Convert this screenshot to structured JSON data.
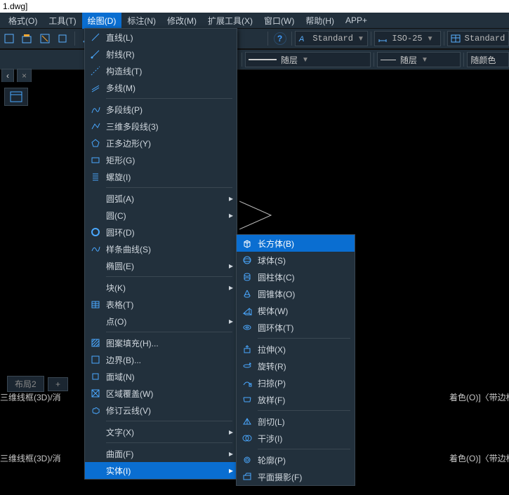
{
  "title": "1.dwg]",
  "menubar": [
    "格式(O)",
    "工具(T)",
    "绘图(D)",
    "标注(N)",
    "修改(M)",
    "扩展工具(X)",
    "窗口(W)",
    "帮助(H)",
    "APP+"
  ],
  "menubar_active": 2,
  "toolbar": {
    "style1": "Standard",
    "style2": "ISO-25",
    "style3": "Standard",
    "layer1": "随层",
    "layer2": "随层",
    "layer3": "随颜色"
  },
  "tabs": {
    "left": "‹",
    "right": "×"
  },
  "draw_menu": [
    {
      "label": "直线(L)",
      "icon": "line-icon"
    },
    {
      "label": "射线(R)",
      "icon": "ray-icon"
    },
    {
      "label": "构造线(T)",
      "icon": "xline-icon"
    },
    {
      "label": "多线(M)",
      "icon": "mline-icon"
    },
    {
      "div": true
    },
    {
      "label": "多段线(P)",
      "icon": "pline-icon"
    },
    {
      "label": "三维多段线(3)",
      "icon": "3dpoly-icon"
    },
    {
      "label": "正多边形(Y)",
      "icon": "polygon-icon"
    },
    {
      "label": "矩形(G)",
      "icon": "rect-icon"
    },
    {
      "label": "螺旋(I)",
      "icon": "helix-icon"
    },
    {
      "div": true
    },
    {
      "label": "圆弧(A)",
      "sub": true
    },
    {
      "label": "圆(C)",
      "sub": true
    },
    {
      "label": "圆环(D)",
      "icon": "donut-icon"
    },
    {
      "label": "样条曲线(S)",
      "icon": "spline-icon"
    },
    {
      "label": "椭圆(E)",
      "sub": true
    },
    {
      "div": true
    },
    {
      "label": "块(K)",
      "sub": true
    },
    {
      "label": "表格(T)",
      "icon": "table-icon"
    },
    {
      "label": "点(O)",
      "sub": true
    },
    {
      "div": true
    },
    {
      "label": "图案填充(H)...",
      "icon": "hatch-icon"
    },
    {
      "label": "边界(B)...",
      "icon": "boundary-icon"
    },
    {
      "label": "面域(N)",
      "icon": "region-icon"
    },
    {
      "label": "区域覆盖(W)",
      "icon": "wipeout-icon"
    },
    {
      "label": "修订云线(V)",
      "icon": "revcloud-icon"
    },
    {
      "div": true
    },
    {
      "label": "文字(X)",
      "sub": true
    },
    {
      "div": true
    },
    {
      "label": "曲面(F)",
      "sub": true
    },
    {
      "label": "实体(I)",
      "sub": true,
      "hi": true
    }
  ],
  "solid_submenu": [
    {
      "label": "长方体(B)",
      "icon": "box-icon",
      "hi": true
    },
    {
      "label": "球体(S)",
      "icon": "sphere-icon"
    },
    {
      "label": "圆柱体(C)",
      "icon": "cylinder-icon"
    },
    {
      "label": "圆锥体(O)",
      "icon": "cone-icon"
    },
    {
      "label": "楔体(W)",
      "icon": "wedge-icon"
    },
    {
      "label": "圆环体(T)",
      "icon": "torus-icon"
    },
    {
      "div": true
    },
    {
      "label": "拉伸(X)",
      "icon": "extrude-icon"
    },
    {
      "label": "旋转(R)",
      "icon": "revolve-icon"
    },
    {
      "label": "扫掠(P)",
      "icon": "sweep-icon"
    },
    {
      "label": "放样(F)",
      "icon": "loft-icon"
    },
    {
      "div": true
    },
    {
      "label": "剖切(L)",
      "icon": "slice-icon"
    },
    {
      "label": "干涉(I)",
      "icon": "interfere-icon"
    },
    {
      "div": true
    },
    {
      "label": "轮廓(P)",
      "icon": "profile-icon"
    },
    {
      "label": "平面摄影(F)",
      "icon": "flatshot-icon"
    }
  ],
  "bottomtabs": {
    "layout": "布局2",
    "plus": "+"
  },
  "status_right": "着色(O)]〈带边框体着色",
  "status_left": "三维线框(3D)/消"
}
